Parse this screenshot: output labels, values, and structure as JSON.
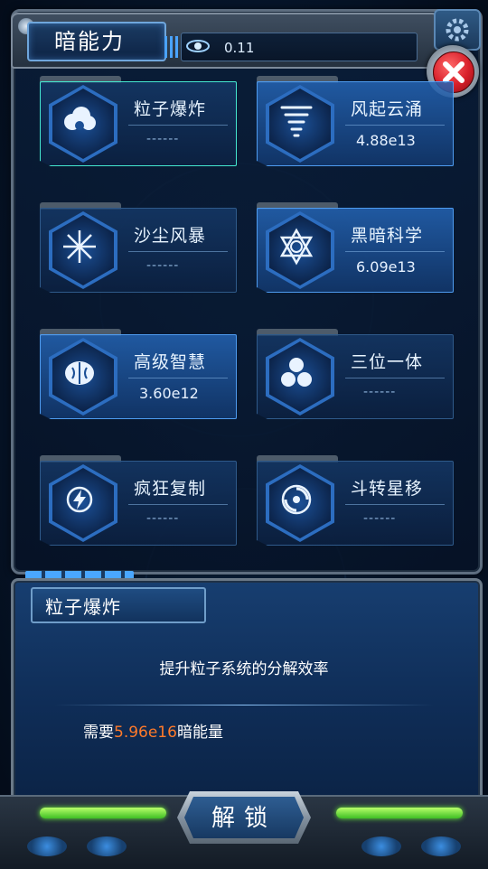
{
  "header": {
    "title": "暗能力",
    "energy_value": "0.11",
    "energy_icon": "galaxy-icon",
    "close_icon": "close-icon",
    "settings_icon": "gear-icon"
  },
  "skills": [
    {
      "name": "粒子爆炸",
      "value": "------",
      "icon": "cloud-bomb-icon",
      "state": "selected"
    },
    {
      "name": "风起云涌",
      "value": "4.88e13",
      "icon": "tornado-icon",
      "state": "lit"
    },
    {
      "name": "沙尘风暴",
      "value": "------",
      "icon": "sandstorm-icon",
      "state": "locked"
    },
    {
      "name": "黑暗科学",
      "value": "6.09e13",
      "icon": "hexagram-icon",
      "state": "lit"
    },
    {
      "name": "高级智慧",
      "value": "3.60e12",
      "icon": "brain-icon",
      "state": "lit"
    },
    {
      "name": "三位一体",
      "value": "------",
      "icon": "trinity-icon",
      "state": "locked"
    },
    {
      "name": "疯狂复制",
      "value": "------",
      "icon": "lightning-icon",
      "state": "locked"
    },
    {
      "name": "斗转星移",
      "value": "------",
      "icon": "vortex-icon",
      "state": "locked"
    }
  ],
  "detail": {
    "title": "粒子爆炸",
    "description": "提升粒子系统的分解效率",
    "cost_prefix": "需要",
    "cost_value": "5.96e16",
    "cost_suffix": "暗能量"
  },
  "actions": {
    "unlock_label": "解锁"
  },
  "colors": {
    "accent": "#4f9cf0",
    "cost_highlight": "#ff7a2a",
    "close_red": "#d81f2a"
  }
}
